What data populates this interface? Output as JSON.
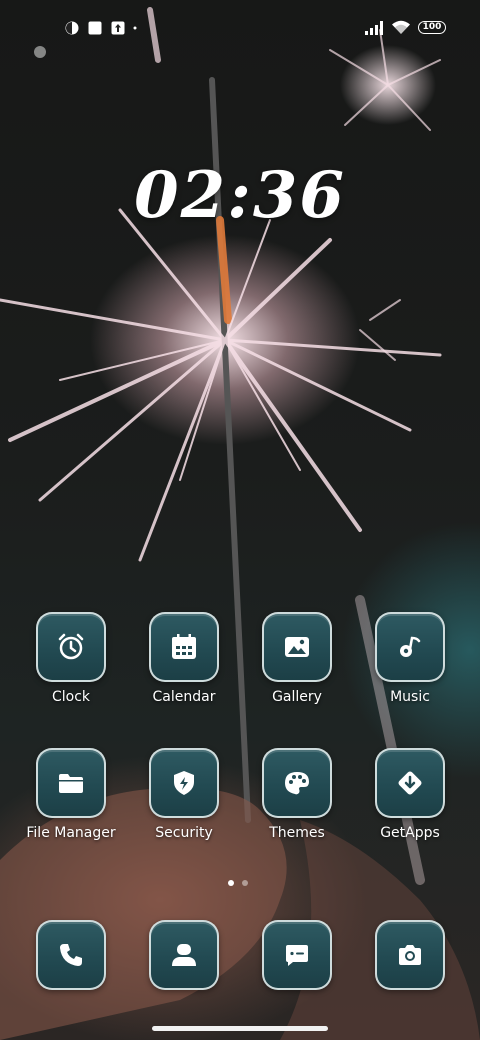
{
  "status_bar": {
    "left_icons": [
      "theme-icon",
      "square-icon",
      "upload-icon"
    ],
    "right_icons": [
      "signal-icon",
      "wifi-icon"
    ],
    "battery": "100"
  },
  "clock_widget": {
    "time": "02:36"
  },
  "apps": [
    {
      "label": "Clock",
      "icon": "alarm-clock-icon"
    },
    {
      "label": "Calendar",
      "icon": "calendar-icon"
    },
    {
      "label": "Gallery",
      "icon": "image-icon"
    },
    {
      "label": "Music",
      "icon": "music-note-icon"
    },
    {
      "label": "File Manager",
      "icon": "folder-icon"
    },
    {
      "label": "Security",
      "icon": "shield-icon"
    },
    {
      "label": "Themes",
      "icon": "palette-icon"
    },
    {
      "label": "GetApps",
      "icon": "download-icon"
    }
  ],
  "page_indicator": {
    "pages": 2,
    "current": 1
  },
  "dock": [
    {
      "name": "Phone",
      "icon": "phone-icon"
    },
    {
      "name": "Contacts",
      "icon": "contact-icon"
    },
    {
      "name": "Messaging",
      "icon": "message-icon"
    },
    {
      "name": "Camera",
      "icon": "camera-icon"
    }
  ],
  "colors": {
    "icon_bg": "#224a52",
    "icon_border": "#e1ebeb",
    "text": "#ffffff"
  }
}
